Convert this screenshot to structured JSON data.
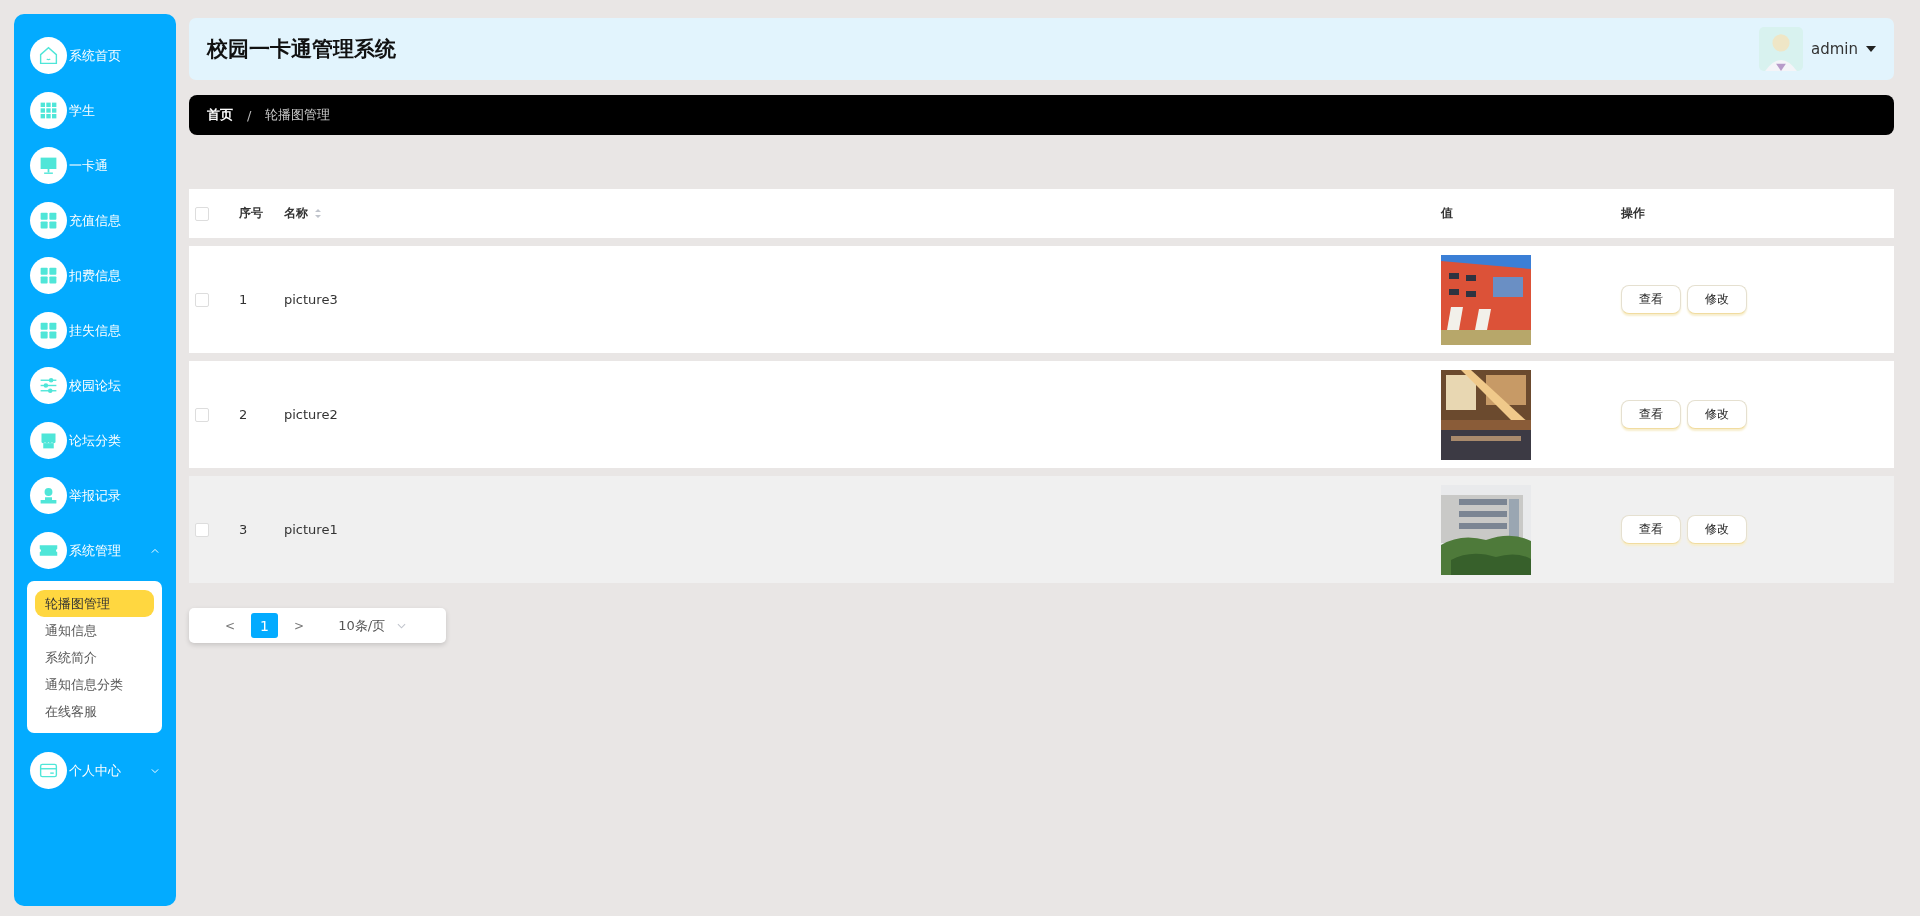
{
  "sidebar": {
    "items": [
      {
        "label": "系统首页",
        "kind": "home"
      },
      {
        "label": "学生",
        "kind": "grid9"
      },
      {
        "label": "一卡通",
        "kind": "monitor"
      },
      {
        "label": "充值信息",
        "kind": "grid4"
      },
      {
        "label": "扣费信息",
        "kind": "grid4"
      },
      {
        "label": "挂失信息",
        "kind": "grid4"
      },
      {
        "label": "校园论坛",
        "kind": "sliders"
      },
      {
        "label": "论坛分类",
        "kind": "shop"
      },
      {
        "label": "举报记录",
        "kind": "person"
      },
      {
        "label": "系统管理",
        "kind": "ticket",
        "expanded": true,
        "children": [
          {
            "label": "轮播图管理",
            "selected": true
          },
          {
            "label": "通知信息",
            "selected": false
          },
          {
            "label": "系统简介",
            "selected": false
          },
          {
            "label": "通知信息分类",
            "selected": false
          },
          {
            "label": "在线客服",
            "selected": false
          }
        ]
      },
      {
        "label": "个人中心",
        "kind": "card",
        "expanded": false
      }
    ]
  },
  "header": {
    "title": "校园一卡通管理系统",
    "user": "admin"
  },
  "breadcrumb": {
    "separator": "/",
    "items": [
      "首页",
      "轮播图管理"
    ]
  },
  "table": {
    "select_all": {
      "checked": false
    },
    "columns": [
      "序号",
      "名称",
      "值",
      "操作"
    ],
    "rows": [
      {
        "checked": false,
        "hovered": false,
        "index": "1",
        "name": "picture3",
        "image": {
          "kind": "picture"
        },
        "actions": [
          "查看",
          "修改"
        ]
      },
      {
        "checked": false,
        "hovered": false,
        "index": "2",
        "name": "picture2",
        "image": {
          "kind": "picture"
        },
        "actions": [
          "查看",
          "修改"
        ]
      },
      {
        "checked": false,
        "hovered": true,
        "index": "3",
        "name": "picture1",
        "image": {
          "kind": "picture"
        },
        "actions": [
          "查看",
          "修改"
        ]
      }
    ]
  },
  "pagination": {
    "prev": "<",
    "pages": [
      {
        "label": "1",
        "selected": true
      }
    ],
    "next": ">",
    "page_size": "10条/页"
  }
}
